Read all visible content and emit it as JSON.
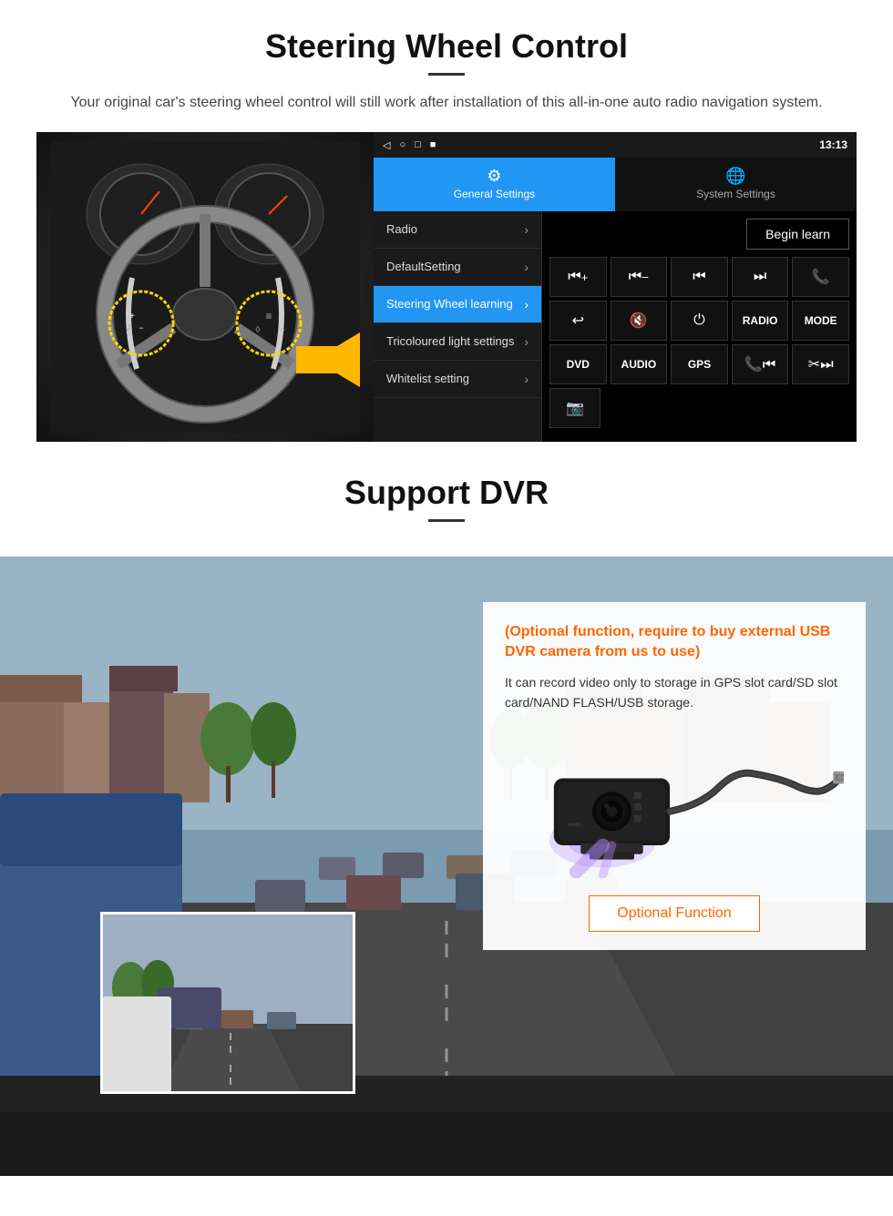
{
  "steering": {
    "title": "Steering Wheel Control",
    "subtitle": "Your original car's steering wheel control will still work after installation of this all-in-one auto radio navigation system.",
    "statusbar": {
      "icons": [
        "◁",
        "○",
        "□",
        "■"
      ],
      "time": "13:13"
    },
    "tabs": [
      {
        "icon": "⚙",
        "label": "General Settings",
        "active": true
      },
      {
        "icon": "🌐",
        "label": "System Settings",
        "active": false
      }
    ],
    "menu_items": [
      {
        "label": "Radio",
        "active": false
      },
      {
        "label": "DefaultSetting",
        "active": false
      },
      {
        "label": "Steering Wheel learning",
        "active": true
      },
      {
        "label": "Tricoloured light settings",
        "active": false
      },
      {
        "label": "Whitelist setting",
        "active": false
      }
    ],
    "begin_learn": "Begin learn",
    "control_buttons": [
      {
        "symbol": "⏮+",
        "type": "icon"
      },
      {
        "symbol": "⏮−",
        "type": "icon"
      },
      {
        "symbol": "⏮",
        "type": "icon"
      },
      {
        "symbol": "⏭",
        "type": "icon"
      },
      {
        "symbol": "📞",
        "type": "icon"
      },
      {
        "symbol": "↩",
        "type": "icon"
      },
      {
        "symbol": "🔇",
        "type": "icon"
      },
      {
        "symbol": "⏻",
        "type": "icon"
      },
      {
        "symbol": "RADIO",
        "type": "text"
      },
      {
        "symbol": "MODE",
        "type": "text"
      },
      {
        "symbol": "DVD",
        "type": "text"
      },
      {
        "symbol": "AUDIO",
        "type": "text"
      },
      {
        "symbol": "GPS",
        "type": "text"
      },
      {
        "symbol": "📞⏮",
        "type": "icon"
      },
      {
        "symbol": "✂⏭",
        "type": "icon"
      }
    ],
    "extra_button": "📷"
  },
  "dvr": {
    "title": "Support DVR",
    "optional_text": "(Optional function, require to buy external USB DVR camera from us to use)",
    "desc_text": "It can record video only to storage in GPS slot card/SD slot card/NAND FLASH/USB storage.",
    "optional_fn_label": "Optional Function"
  }
}
